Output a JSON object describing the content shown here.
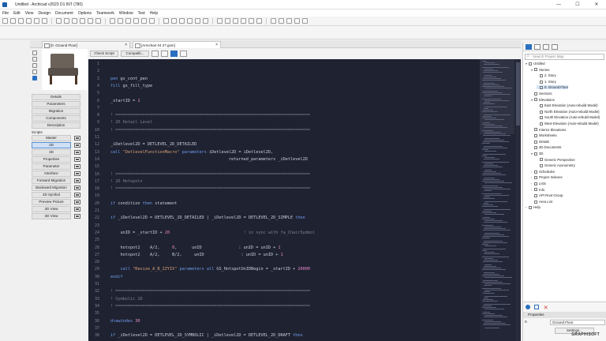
{
  "window": {
    "title": "Untitled - Archicad v2023 D1 INT (780)",
    "minimize": "—",
    "maximize": "☐",
    "close": "✕"
  },
  "menu": [
    "File",
    "Edit",
    "View",
    "Design",
    "Document",
    "Options",
    "Teamwork",
    "Window",
    "Test",
    "Help"
  ],
  "tabs": [
    {
      "label": "[0. Ground Floor]"
    },
    {
      "label": "[Armchair 04 27.gsm]"
    }
  ],
  "editor_toolbar": {
    "check_script": "Check Script",
    "compatibility": "Compatib..."
  },
  "left_panel": {
    "buttons": [
      "Details",
      "Parameters",
      "Migration",
      "Components",
      "Description"
    ],
    "scripts_label": "Scripts",
    "scripts": [
      "Master",
      "2D",
      "3D",
      "Properties",
      "Parameter",
      "Interface",
      "Forward Migration",
      "Backward Migration",
      "2D Symbol",
      "Preview Picture",
      "2D View",
      "3D View"
    ],
    "selected_script": "2D"
  },
  "code_lines": [
    {
      "n": "1",
      "parts": []
    },
    {
      "n": "2",
      "parts": []
    },
    {
      "n": "3",
      "parts": [
        {
          "t": "pen",
          "c": "kw"
        },
        {
          "t": " gs_cont_pen",
          "c": "id"
        }
      ]
    },
    {
      "n": "4",
      "parts": [
        {
          "t": "fill",
          "c": "kw"
        },
        {
          "t": " gs_fill_type",
          "c": "id"
        }
      ]
    },
    {
      "n": "5",
      "parts": []
    },
    {
      "n": "6",
      "parts": [
        {
          "t": "_startID = ",
          "c": "id"
        },
        {
          "t": "1",
          "c": "num"
        }
      ]
    },
    {
      "n": "7",
      "parts": []
    },
    {
      "n": "8",
      "parts": [
        {
          "t": "! ===============================================================================",
          "c": "cm"
        }
      ]
    },
    {
      "n": "9",
      "parts": [
        {
          "t": "! 2D Detail Level",
          "c": "cm"
        }
      ]
    },
    {
      "n": "10",
      "parts": [
        {
          "t": "! ===============================================================================",
          "c": "cm"
        }
      ]
    },
    {
      "n": "11",
      "parts": []
    },
    {
      "n": "12",
      "parts": [
        {
          "t": "_iDetlevel2D = DETLEVEL_2D_DETAILED",
          "c": "id"
        }
      ]
    },
    {
      "n": "13",
      "parts": [
        {
          "t": "call",
          "c": "kw"
        },
        {
          "t": " \"DetlevelFunctionMacro\"",
          "c": "str"
        },
        {
          "t": " parameters",
          "c": "kw"
        },
        {
          "t": " iDetlevel2D = iDetlevel2D,",
          "c": "id"
        }
      ]
    },
    {
      "n": "14",
      "parts": [
        {
          "t": "                                                returned_parameters _iDetlevel2D",
          "c": "id"
        }
      ]
    },
    {
      "n": "15",
      "parts": []
    },
    {
      "n": "16",
      "parts": [
        {
          "t": "! ===============================================================================",
          "c": "cm"
        }
      ]
    },
    {
      "n": "17",
      "parts": [
        {
          "t": "! 2D Hotspots",
          "c": "cm"
        }
      ]
    },
    {
      "n": "18",
      "parts": [
        {
          "t": "! ===============================================================================",
          "c": "cm"
        }
      ]
    },
    {
      "n": "19",
      "parts": []
    },
    {
      "n": "20",
      "parts": [
        {
          "t": "if",
          "c": "kw"
        },
        {
          "t": " condition ",
          "c": "id"
        },
        {
          "t": "then",
          "c": "kw"
        },
        {
          "t": " statement",
          "c": "id"
        }
      ]
    },
    {
      "n": "21",
      "parts": []
    },
    {
      "n": "22",
      "parts": [
        {
          "t": "if",
          "c": "kw"
        },
        {
          "t": " _iDetlevel2D = DETLEVEL_2D_DETAILED | _iDetlevel2D = DETLEVEL_2D_SIMPLE ",
          "c": "id"
        },
        {
          "t": "then",
          "c": "kw"
        }
      ]
    },
    {
      "n": "23",
      "parts": []
    },
    {
      "n": "24",
      "parts": [
        {
          "t": "    unID = _startID + ",
          "c": "id"
        },
        {
          "t": "20",
          "c": "num"
        },
        {
          "t": "                              ! in sync with fa_ChairSymbol",
          "c": "cm"
        }
      ]
    },
    {
      "n": "25",
      "parts": []
    },
    {
      "n": "26",
      "parts": [
        {
          "t": "    hotspot2    A/2,     ",
          "c": "id"
        },
        {
          "t": "0",
          "c": "num"
        },
        {
          "t": ",      unID               : unID = unID + ",
          "c": "id"
        },
        {
          "t": "1",
          "c": "num"
        }
      ]
    },
    {
      "n": "27",
      "parts": [
        {
          "t": "    hotspot2    A/2,     B/2,     unID               : unID = unID + ",
          "c": "id"
        },
        {
          "t": "1",
          "c": "num"
        }
      ]
    },
    {
      "n": "28",
      "parts": []
    },
    {
      "n": "29",
      "parts": [
        {
          "t": "    call",
          "c": "kw"
        },
        {
          "t": " \"Resize_A_B_2ZYIX\"",
          "c": "str"
        },
        {
          "t": " parameters all",
          "c": "kw"
        },
        {
          "t": " GS_HotspotUnIDBegin = _startID + ",
          "c": "id"
        },
        {
          "t": "20000",
          "c": "num"
        }
      ]
    },
    {
      "n": "30",
      "parts": [
        {
          "t": "endif",
          "c": "kw"
        }
      ]
    },
    {
      "n": "31",
      "parts": []
    },
    {
      "n": "32",
      "parts": [
        {
          "t": "! ===============================================================================",
          "c": "cm"
        }
      ]
    },
    {
      "n": "33",
      "parts": [
        {
          "t": "! Symbolic 2D",
          "c": "cm"
        }
      ]
    },
    {
      "n": "34",
      "parts": [
        {
          "t": "! ===============================================================================",
          "c": "cm"
        }
      ]
    },
    {
      "n": "35",
      "parts": []
    },
    {
      "n": "36",
      "parts": [
        {
          "t": "drawindex",
          "c": "kw"
        },
        {
          "t": " 30",
          "c": "num"
        }
      ]
    },
    {
      "n": "37",
      "parts": []
    },
    {
      "n": "38",
      "parts": [
        {
          "t": "if",
          "c": "kw"
        },
        {
          "t": " _iDetlevel2D = DETLEVEL_2D_SYMBOLIC | _iDetlevel2D = DETLEVEL_2D_DRAFT ",
          "c": "id"
        },
        {
          "t": "then",
          "c": "kw"
        }
      ]
    }
  ],
  "colors": {
    "kw": "#6f9cf0",
    "id": "#c9cfdd",
    "num": "#e88ad0",
    "str": "#d6a27a",
    "cm": "#7a8094"
  },
  "project_map": {
    "search_placeholder": "Search Project Map",
    "items": [
      {
        "label": "Untitled",
        "level": 0,
        "arrow": "▾"
      },
      {
        "label": "Stories",
        "level": 1,
        "arrow": "▾"
      },
      {
        "label": "2. Story",
        "level": 2,
        "arrow": ""
      },
      {
        "label": "1. Story",
        "level": 2,
        "arrow": ""
      },
      {
        "label": "0. Ground Floor",
        "level": 2,
        "arrow": "",
        "selected": true
      },
      {
        "label": "Sections",
        "level": 1,
        "arrow": ""
      },
      {
        "label": "Elevations",
        "level": 1,
        "arrow": "▾"
      },
      {
        "label": "East Elevation (Auto-rebuild Model)",
        "level": 2,
        "arrow": ""
      },
      {
        "label": "North Elevation (Auto-rebuild Model)",
        "level": 2,
        "arrow": ""
      },
      {
        "label": "South Elevation (Auto-rebuild Model)",
        "level": 2,
        "arrow": ""
      },
      {
        "label": "West Elevation (Auto-rebuild Model)",
        "level": 2,
        "arrow": ""
      },
      {
        "label": "Interior Elevations",
        "level": 1,
        "arrow": ""
      },
      {
        "label": "Worksheets",
        "level": 1,
        "arrow": ""
      },
      {
        "label": "Details",
        "level": 1,
        "arrow": ""
      },
      {
        "label": "3D Documents",
        "level": 1,
        "arrow": ""
      },
      {
        "label": "3D",
        "level": 1,
        "arrow": "▾"
      },
      {
        "label": "Generic Perspective",
        "level": 2,
        "arrow": ""
      },
      {
        "label": "Generic Axonometry",
        "level": 2,
        "arrow": ""
      },
      {
        "label": "Schedules",
        "level": 1,
        "arrow": "›"
      },
      {
        "label": "Project Indexes",
        "level": 1,
        "arrow": "›"
      },
      {
        "label": "Lists",
        "level": 1,
        "arrow": "›"
      },
      {
        "label": "Info",
        "level": 1,
        "arrow": "›"
      },
      {
        "label": "API Root Group",
        "level": 1,
        "arrow": ""
      },
      {
        "label": "Area List",
        "level": 1,
        "arrow": ""
      },
      {
        "label": "Help",
        "level": 0,
        "arrow": "›"
      }
    ]
  },
  "properties": {
    "header": "Properties",
    "field_label": "0.",
    "field_value": "Ground Floor",
    "settings": "Settings..."
  },
  "brand": "GRAPHISOFT"
}
